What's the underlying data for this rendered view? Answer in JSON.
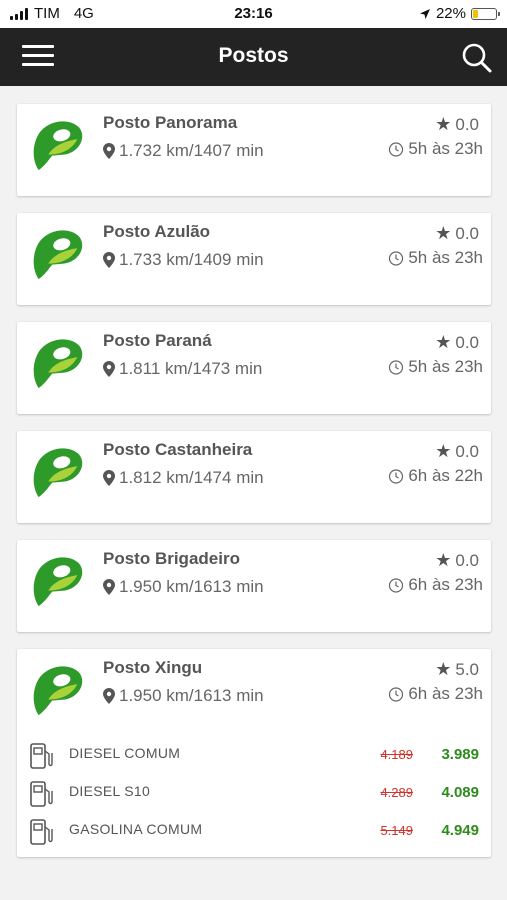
{
  "status_bar": {
    "carrier": "TIM",
    "network": "4G",
    "time": "23:16",
    "battery": "22%",
    "battery_color": "#f2c200"
  },
  "header": {
    "title": "Postos",
    "menu_icon": "hamburger-icon",
    "search_icon": "search-icon",
    "background": "#232323"
  },
  "stations": [
    {
      "name": "Posto Panorama",
      "distance": "1.732 km/1407 min",
      "rating": "0.0",
      "hours": "5h às 23h"
    },
    {
      "name": "Posto Azulão",
      "distance": "1.733 km/1409 min",
      "rating": "0.0",
      "hours": "5h às 23h"
    },
    {
      "name": "Posto Paraná",
      "distance": "1.811 km/1473 min",
      "rating": "0.0",
      "hours": "5h às 23h"
    },
    {
      "name": "Posto Castanheira",
      "distance": "1.812 km/1474 min",
      "rating": "0.0",
      "hours": "6h às 22h"
    },
    {
      "name": "Posto Brigadeiro",
      "distance": "1.950 km/1613 min",
      "rating": "0.0",
      "hours": "6h às 23h"
    },
    {
      "name": "Posto Xingu",
      "distance": "1.950 km/1613 min",
      "rating": "5.0",
      "hours": "6h às 23h",
      "fuels": [
        {
          "name": "DIESEL COMUM",
          "old_price": "4.189",
          "new_price": "3.989"
        },
        {
          "name": "DIESEL S10",
          "old_price": "4.289",
          "new_price": "4.089"
        },
        {
          "name": "GASOLINA COMUM",
          "old_price": "5.149",
          "new_price": "4.949"
        }
      ]
    }
  ],
  "colors": {
    "brand_green": "#2e9a2a",
    "price_old": "#d0342c",
    "price_new": "#2e8b1e"
  }
}
